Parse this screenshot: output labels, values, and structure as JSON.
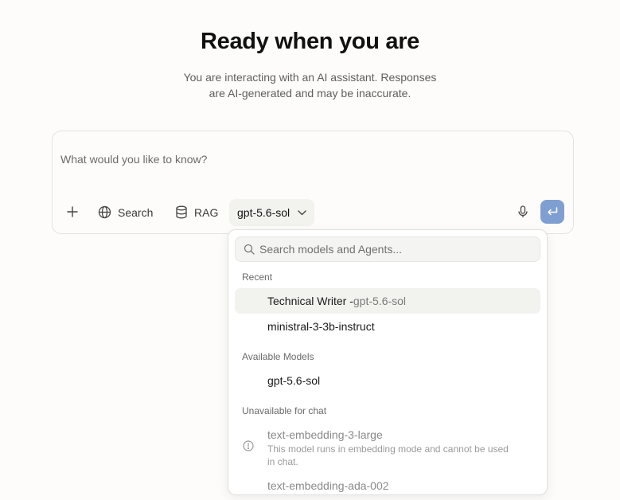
{
  "hero": {
    "title": "Ready when you are",
    "subtitle_line1": "You are interacting with an AI assistant. Responses",
    "subtitle_line2": "are AI-generated and may be inaccurate."
  },
  "composer": {
    "placeholder": "What would you like to know?",
    "value": "",
    "search_label": "Search",
    "rag_label": "RAG",
    "model_label": "gpt-5.6-sol"
  },
  "model_menu": {
    "search_placeholder": "Search models and Agents...",
    "recent_heading": "Recent",
    "recent": [
      {
        "name": "Technical Writer - ",
        "model": "gpt-5.6-sol",
        "highlighted": true
      },
      {
        "name": "ministral-3-3b-instruct",
        "model": ""
      }
    ],
    "available_heading": "Available Models",
    "available": [
      {
        "name": "gpt-5.6-sol"
      }
    ],
    "unavailable_heading": "Unavailable for chat",
    "unavailable": [
      {
        "name": "text-embedding-3-large",
        "desc": "This model runs in embedding mode and cannot be used in chat."
      },
      {
        "name": "text-embedding-ada-002",
        "desc": ""
      }
    ]
  },
  "colors": {
    "send_button": "#7f9fd2",
    "background": "#fdfcfa"
  }
}
